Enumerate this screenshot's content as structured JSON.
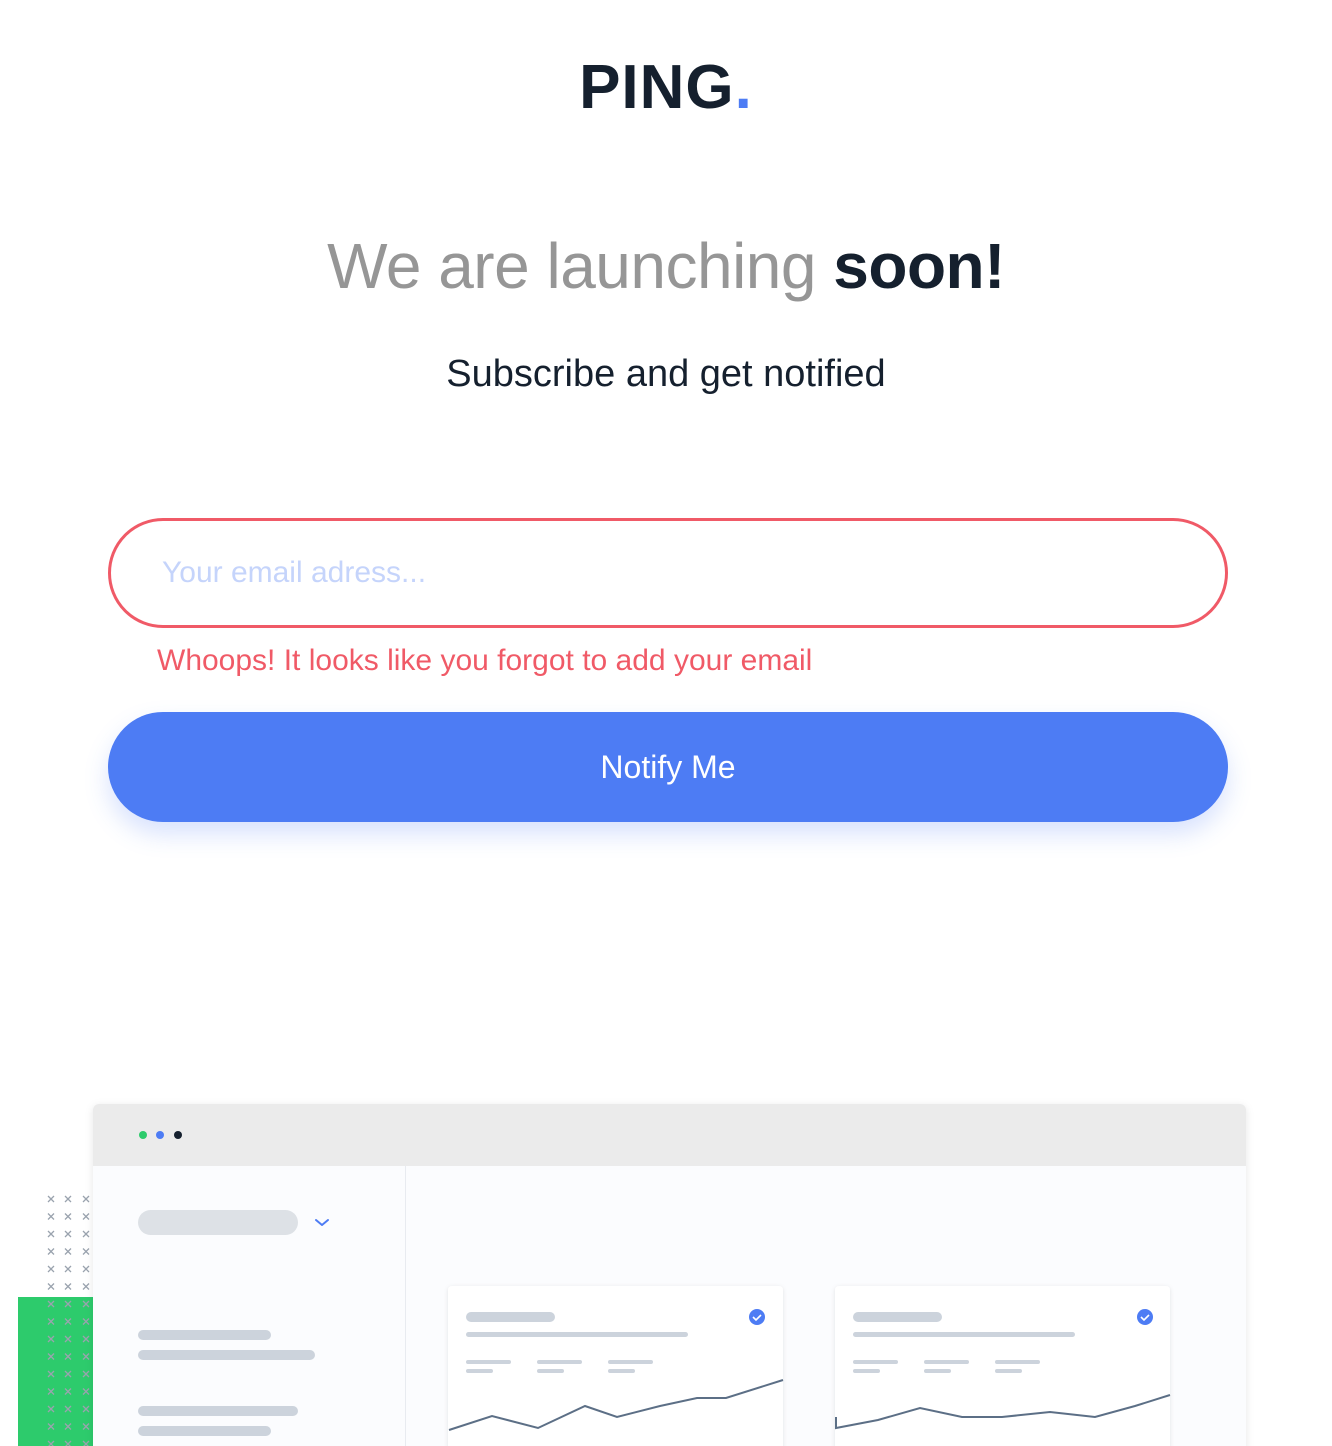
{
  "header": {
    "logo_text": "PING",
    "logo_dot": "."
  },
  "hero": {
    "title_light": "We are launching ",
    "title_bold": "soon!",
    "subtitle": "Subscribe and get notified"
  },
  "form": {
    "email_placeholder": "Your email adress...",
    "email_value": "",
    "error_message": "Whoops! It looks like you forgot to add your email",
    "submit_label": "Notify Me"
  },
  "colors": {
    "accent": "#4d7cf4",
    "error": "#f05a67",
    "dark": "#15202e",
    "muted": "#969696",
    "dashboard_green": "#2dcb6c"
  },
  "illustration": {
    "icon": "dashboard-mockup",
    "window_dots": [
      "#2dcb6c",
      "#4d7cf4",
      "#15202e"
    ]
  }
}
